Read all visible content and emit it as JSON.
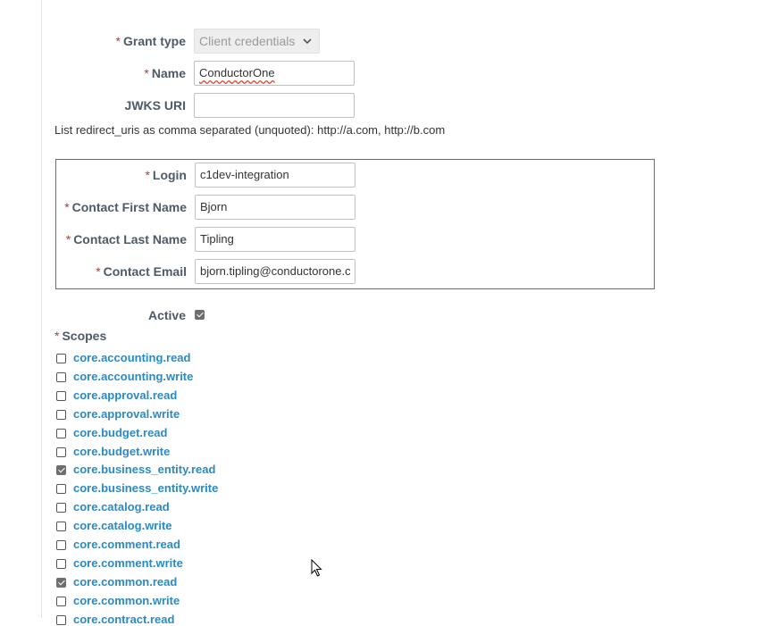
{
  "form": {
    "grant_type": {
      "required": "*",
      "label": "Grant type",
      "value": "Client credentials"
    },
    "name": {
      "required": "*",
      "label": "Name",
      "value": "ConductorOne"
    },
    "jwks_uri": {
      "label": "JWKS URI",
      "value": ""
    },
    "redirect_hint": "List redirect_uris as comma separated (unquoted): http://a.com, http://b.com",
    "login": {
      "required": "*",
      "label": "Login",
      "value": "c1dev-integration"
    },
    "contact_first_name": {
      "required": "*",
      "label": "Contact First Name",
      "value": "Bjorn"
    },
    "contact_last_name": {
      "required": "*",
      "label": "Contact Last Name",
      "value": "Tipling"
    },
    "contact_email": {
      "required": "*",
      "label": "Contact Email",
      "value": "bjorn.tipling@conductorone.c"
    },
    "active": {
      "label": "Active",
      "checked": true
    },
    "scopes": {
      "required": "*",
      "label": "Scopes",
      "items": [
        {
          "label": "core.accounting.read",
          "checked": false
        },
        {
          "label": "core.accounting.write",
          "checked": false
        },
        {
          "label": "core.approval.read",
          "checked": false
        },
        {
          "label": "core.approval.write",
          "checked": false
        },
        {
          "label": "core.budget.read",
          "checked": false
        },
        {
          "label": "core.budget.write",
          "checked": false
        },
        {
          "label": "core.business_entity.read",
          "checked": true
        },
        {
          "label": "core.business_entity.write",
          "checked": false
        },
        {
          "label": "core.catalog.read",
          "checked": false
        },
        {
          "label": "core.catalog.write",
          "checked": false
        },
        {
          "label": "core.comment.read",
          "checked": false
        },
        {
          "label": "core.comment.write",
          "checked": false
        },
        {
          "label": "core.common.read",
          "checked": true
        },
        {
          "label": "core.common.write",
          "checked": false
        },
        {
          "label": "core.contract.read",
          "checked": false
        }
      ]
    }
  },
  "colors": {
    "required": "#c0392b",
    "link": "#2a8ac4",
    "label": "#4e5a66"
  }
}
